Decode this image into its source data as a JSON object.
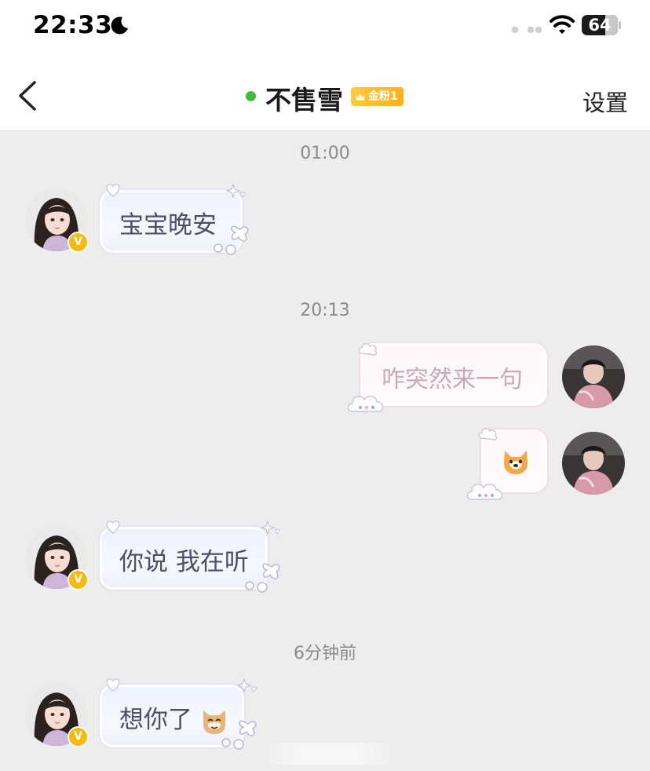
{
  "status_bar": {
    "time": "22:33",
    "battery": "64",
    "icons": [
      "moon-icon",
      "signal-dots-icon",
      "wifi-icon",
      "battery-icon"
    ]
  },
  "nav": {
    "back_icon": "chevron-left-icon",
    "title": "不售雪",
    "online": true,
    "badge": "金粉1",
    "settings": "设置"
  },
  "colors": {
    "online": "#3fbd3a",
    "badge": "#ffb018",
    "vip": "#f6b90d",
    "background": "#ededed"
  },
  "chat": {
    "messages": [
      {
        "timestamp": "01:00"
      },
      {
        "sender": "other",
        "text": "宝宝晚安",
        "avatar_badge": "V"
      },
      {
        "timestamp": "20:13"
      },
      {
        "sender": "me",
        "text": "咋突然来一句"
      },
      {
        "sender": "me",
        "emoji": "dog-face-emoji"
      },
      {
        "sender": "other",
        "text": "你说 我在听",
        "avatar_badge": "V"
      },
      {
        "timestamp": "6分钟前"
      },
      {
        "sender": "other",
        "text": "想你了",
        "emoji": "cat-face-emoji",
        "avatar_badge": "V"
      }
    ]
  }
}
